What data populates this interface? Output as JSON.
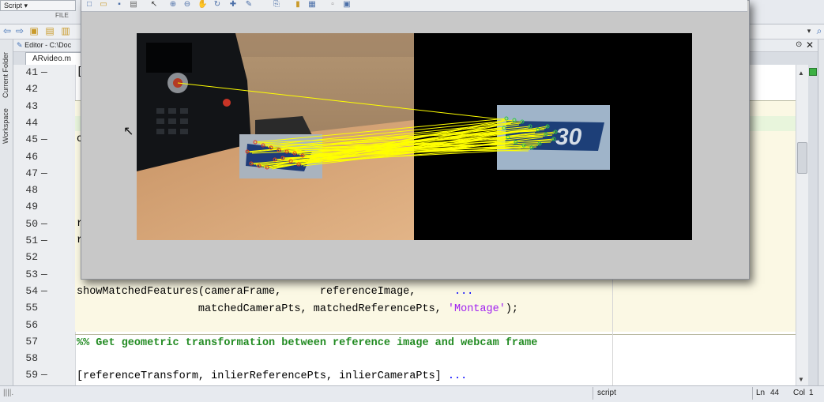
{
  "topbar": {
    "script_dropdown": "Script",
    "file_label": "FILE"
  },
  "editor": {
    "title": "Editor - C:\\Doc",
    "tab": "ARvideo.m",
    "lines": [
      {
        "n": "41",
        "dash": "—",
        "code": "["
      },
      {
        "n": "42",
        "dash": "",
        "code": ""
      },
      {
        "n": "43",
        "dash": "",
        "code": ""
      },
      {
        "n": "44",
        "dash": "",
        "code": ""
      },
      {
        "n": "45",
        "dash": "—",
        "code": "c"
      },
      {
        "n": "46",
        "dash": "",
        "code": ""
      },
      {
        "n": "47",
        "dash": "—",
        "code": ""
      },
      {
        "n": "48",
        "dash": "",
        "code": ""
      },
      {
        "n": "49",
        "dash": "",
        "code": ""
      },
      {
        "n": "50",
        "dash": "—",
        "code": "r"
      },
      {
        "n": "51",
        "dash": "—",
        "code": "r"
      },
      {
        "n": "52",
        "dash": "",
        "code": ""
      },
      {
        "n": "53",
        "dash": "—",
        "code": ""
      },
      {
        "n": "54",
        "dash": "—",
        "code": ""
      },
      {
        "n": "55",
        "dash": "",
        "code": ""
      },
      {
        "n": "56",
        "dash": "",
        "code": ""
      },
      {
        "n": "57",
        "dash": "",
        "code": ""
      },
      {
        "n": "58",
        "dash": "",
        "code": ""
      },
      {
        "n": "59",
        "dash": "—",
        "code": ""
      }
    ],
    "line54_code": "showMatchedFeatures(cameraFrame,      referenceImage,      ",
    "line54_ellipsis": "...",
    "line55_code": "                   matchedCameraPts, matchedReferencePts, ",
    "line55_string": "'Montage'",
    "line55_end": ");",
    "line57_comment": "%% Get geometric transformation between reference image and webcam frame",
    "line59_code": "[referenceTransform, inlierReferencePts, inlierCameraPts] ",
    "line59_ellipsis": "..."
  },
  "left_tabs": {
    "current_folder": "Current Folder",
    "workspace": "Workspace"
  },
  "status": {
    "mode": "script",
    "ln_label": "Ln",
    "ln_value": "44",
    "col_label": "Col",
    "col_value": "1"
  },
  "figure": {
    "reference_badge_text": "30"
  },
  "colors": {
    "cell_bg": "#fbf8e4",
    "comment": "#228b22",
    "string": "#a020f0",
    "match_lines": "#ffff00"
  }
}
